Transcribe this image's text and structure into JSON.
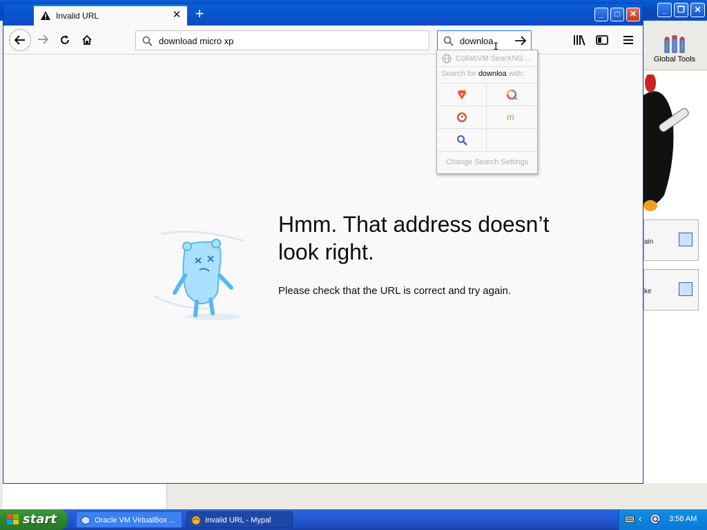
{
  "background_app": {
    "global_tools_label": "Global Tools",
    "card_1_label": "ain",
    "card_2_label": "ke"
  },
  "browser": {
    "tab": {
      "title": "Invalid URL",
      "close": "✕"
    },
    "new_tab": "+",
    "window_controls": {
      "minimize": "_",
      "maximize": "□",
      "close": "✕"
    },
    "url_text": "download micro xp",
    "search_text": "downloa",
    "error": {
      "title": "Hmm. That address doesn’t look right.",
      "description": "Please check that the URL is correct and try again."
    }
  },
  "search_popup": {
    "engine_name": "CollabVM SearXNG ...",
    "search_for_prefix": "Search for ",
    "search_for_term": "downloa",
    "search_for_suffix": " with:",
    "engines": [
      "brave-icon",
      "qwant-icon",
      "duckduckgo-icon",
      "mojeek-icon",
      "search-engine-icon"
    ],
    "settings_label": "Change Search Settings"
  },
  "taskbar": {
    "start_label": "start",
    "tasks": [
      {
        "label": "Oracle VM VirtualBox ...",
        "icon": "virtualbox-icon",
        "active": false
      },
      {
        "label": "Invalid URL - Mypal",
        "icon": "mypal-icon",
        "active": true
      }
    ],
    "clock": "3:58 AM"
  },
  "colors": {
    "xp_blue": "#0a5ed8",
    "accent_blue": "#0a84ff",
    "start_green": "#2f8a2f",
    "page_bg": "#f9f9fa"
  }
}
